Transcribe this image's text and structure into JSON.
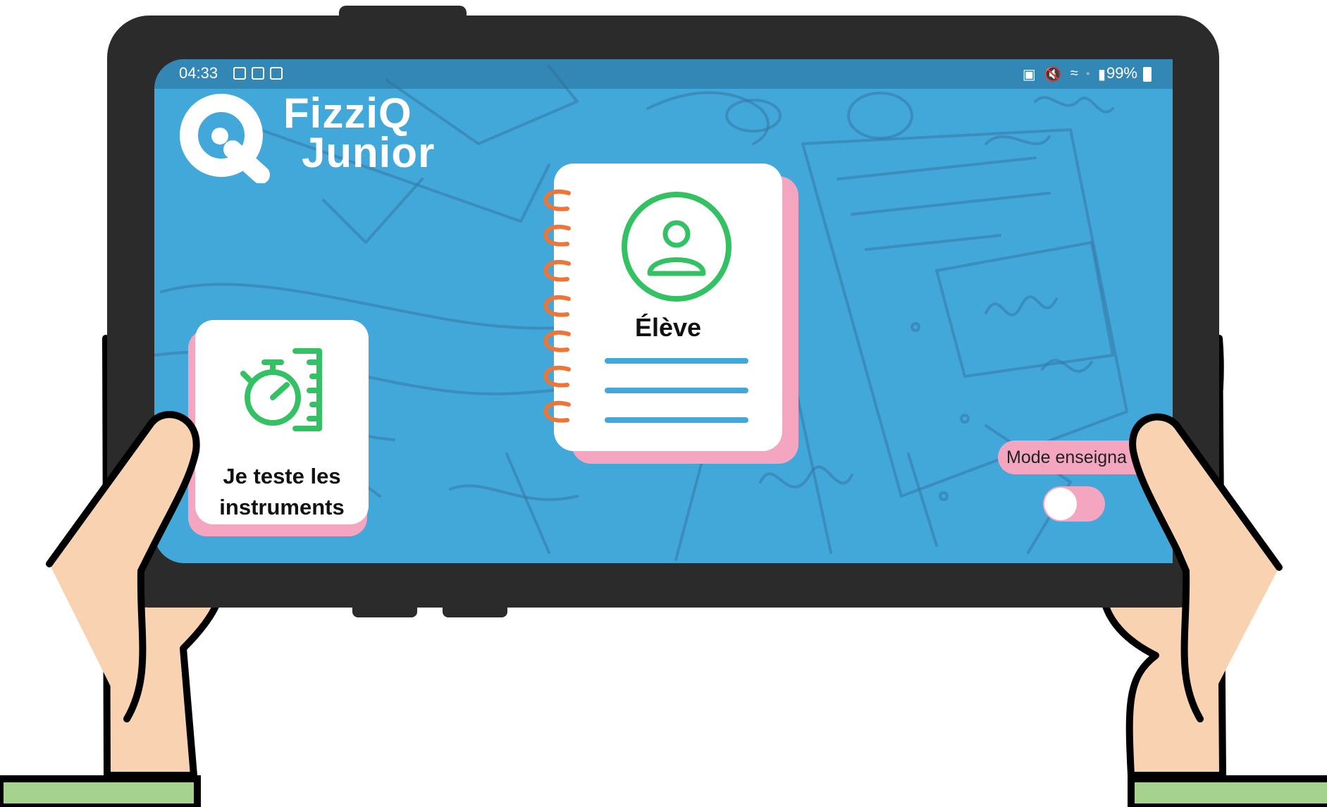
{
  "status_bar": {
    "time": "04:33",
    "battery": "99%",
    "left_icons": [
      "gallery-notification-icon",
      "keyboard-notification-icon",
      "recorder-notification-icon"
    ],
    "right_icons": [
      "battery-saver-icon",
      "mute-icon",
      "wifi-icon",
      "volte-icon",
      "signal-icon",
      "battery-icon"
    ]
  },
  "app": {
    "logo_line1": "FizziQ",
    "logo_line2": "Junior"
  },
  "notebook": {
    "title": "Élève",
    "icon": "user-profile-icon"
  },
  "instruments_card": {
    "label_line1": "Je teste les",
    "label_line2": "instruments",
    "icon": "stopwatch-ruler-icon"
  },
  "teacher_mode": {
    "label": "Mode enseigna",
    "toggle_state": "off"
  },
  "colors": {
    "screen_background": "#42a7d9",
    "accent_green": "#34c163",
    "accent_pink": "#f4a5c0",
    "spiral_orange": "#ee7538",
    "device_frame": "#2b2b2b",
    "skin": "#f9d3b1",
    "sleeve": "#a5d28d"
  }
}
